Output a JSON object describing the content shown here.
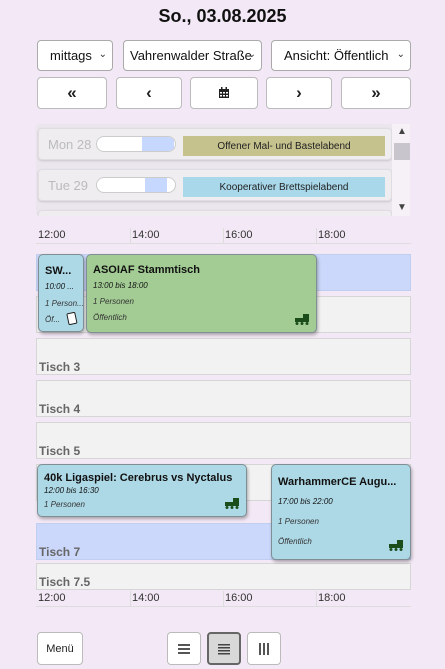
{
  "header": {
    "date": "So., 03.08.2025"
  },
  "filters": {
    "time": "mittags",
    "location": "Vahrenwalder Straße",
    "view": "Ansicht: Öffentlich"
  },
  "nav": {
    "prev_week": "«",
    "prev_day": "‹",
    "today": "▦",
    "next_day": "›",
    "next_week": "»"
  },
  "week_list": [
    {
      "day": "Mon 28",
      "event": "Offener Mal- und Bastelabend",
      "color": "#c6c28e"
    },
    {
      "day": "Tue 29",
      "event": "Kooperativer Brettspielabend",
      "color": "#a9d8ea"
    }
  ],
  "timeline": {
    "hours": [
      "12:00",
      "14:00",
      "16:00",
      "18:00"
    ]
  },
  "tables": [
    "",
    "",
    "Tisch 3",
    "Tisch 4",
    "Tisch 5",
    "",
    "Tisch 7",
    "Tisch 7.5"
  ],
  "events": {
    "sw": {
      "title": "SW...",
      "time": "10:00 ...",
      "persons": "1 Person...",
      "visibility": "Öf..."
    },
    "asoiaf": {
      "title": "ASOIAF Stammtisch",
      "time": "13:00 bis 18:00",
      "persons": "1 Personen",
      "visibility": "Öffentlich"
    },
    "ligaspiel": {
      "title": "40k Ligaspiel: Cerebrus vs Nyctalus",
      "time": "12:00 bis 16:30",
      "persons": "1 Personen"
    },
    "warhammer": {
      "title": "WarhammerCE Augu...",
      "time": "17:00 bis 22:00",
      "persons": "1 Personen",
      "visibility": "Öffentlich"
    }
  },
  "footer": {
    "menu": "Menü",
    "view_list": "☰",
    "view_compact": "☷",
    "view_columns": "▥"
  }
}
